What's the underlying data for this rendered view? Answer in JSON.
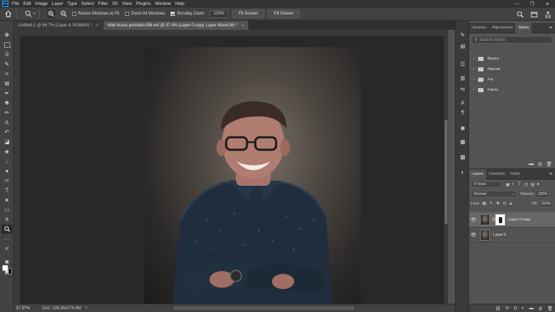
{
  "menubar": {
    "app_logo": "Ps",
    "items": [
      "File",
      "Edit",
      "Image",
      "Layer",
      "Type",
      "Select",
      "Filter",
      "3D",
      "View",
      "Plugins",
      "Window",
      "Help"
    ],
    "window_controls": [
      "—",
      "❐",
      "✕"
    ]
  },
  "options_bar": {
    "resize_windows_label": "Resize Windows to Fit",
    "resize_windows_checked": false,
    "zoom_all_label": "Zoom All Windows",
    "zoom_all_checked": false,
    "scrubby_zoom_label": "Scrubby Zoom",
    "scrubby_zoom_checked": true,
    "zoom_value": "100%",
    "fit_screen_label": "Fit Screen",
    "fill_screen_label": "Fill Screen"
  },
  "tabs": [
    {
      "label": "Untitled-1 @ 66.7% (Layer 4, RGB/8#) *",
      "active": false
    },
    {
      "label": "Matt music portraits-006.nef @ 37.4% (Layer 0 copy, Layer Mask/16) *",
      "active": true
    }
  ],
  "status_bar": {
    "zoom": "37.37%",
    "doc_info": "Doc: 138.2M/276.9M",
    "arrow": ">"
  },
  "styles_panel": {
    "tabs": [
      "Libraries",
      "Adjustments",
      "Styles"
    ],
    "active_tab": "Styles",
    "search_placeholder": "Search Styles",
    "groups": [
      "Basics",
      "Natural",
      "Fur",
      "Fabric"
    ]
  },
  "layers_panel": {
    "tabs": [
      "Layers",
      "Channels",
      "Paths"
    ],
    "active_tab": "Layers",
    "filter_kind": "Kind",
    "blend_mode": "Normal",
    "opacity_label": "Opacity:",
    "opacity_value": "100%",
    "lock_label": "Lock:",
    "fill_label": "Fill:",
    "fill_value": "100%",
    "layers": [
      {
        "name": "Layer 0 copy",
        "visible": true,
        "has_mask": true,
        "selected": true
      },
      {
        "name": "Layer 0",
        "visible": true,
        "has_mask": false,
        "selected": false
      }
    ],
    "footer_icons": [
      "link-icon",
      "fx-icon",
      "mask-icon",
      "adjustment-icon",
      "group-icon",
      "new-layer-icon",
      "trash-icon"
    ]
  }
}
